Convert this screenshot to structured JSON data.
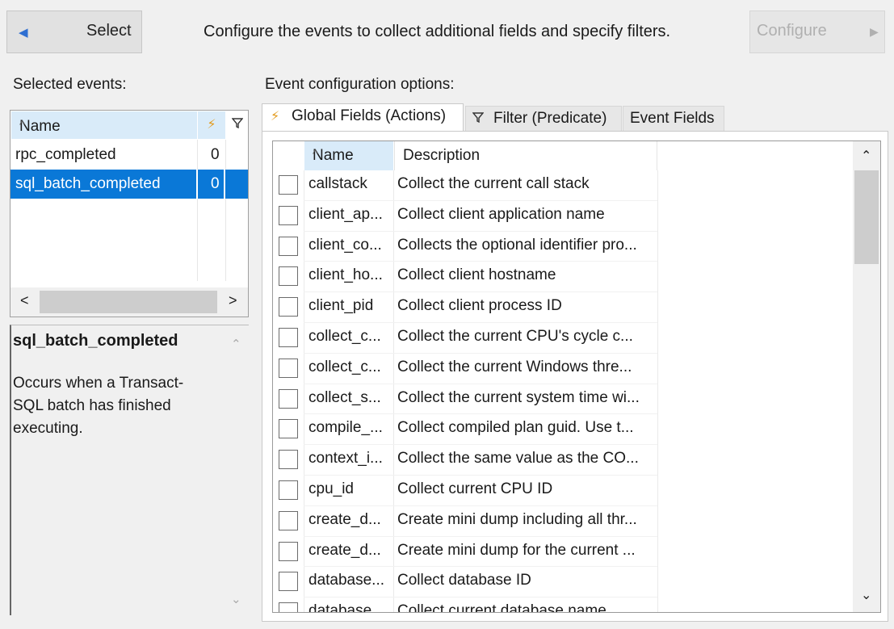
{
  "toolbar": {
    "select_label": "Select",
    "instruction": "Configure the events to collect additional fields and specify filters.",
    "configure_label": "Configure"
  },
  "selected_events": {
    "label": "Selected events:",
    "columns": {
      "name": "Name"
    },
    "rows": [
      {
        "name": "rpc_completed",
        "actions": "0",
        "selected": false
      },
      {
        "name": "sql_batch_completed",
        "actions": "0",
        "selected": true
      }
    ]
  },
  "description": {
    "title": "sql_batch_completed",
    "body": "Occurs when a Transact-SQL batch has finished executing."
  },
  "config": {
    "label": "Event configuration options:",
    "tabs": [
      {
        "label": "Global Fields (Actions)",
        "active": true
      },
      {
        "label": "Filter (Predicate)",
        "active": false
      },
      {
        "label": "Event Fields",
        "active": false
      }
    ],
    "grid": {
      "columns": {
        "name": "Name",
        "description": "Description"
      },
      "rows": [
        {
          "name": "callstack",
          "description": "Collect the current call stack"
        },
        {
          "name": "client_ap...",
          "description": "Collect client application name"
        },
        {
          "name": "client_co...",
          "description": "Collects the optional identifier pro..."
        },
        {
          "name": "client_ho...",
          "description": "Collect client hostname"
        },
        {
          "name": "client_pid",
          "description": "Collect client process ID"
        },
        {
          "name": "collect_c...",
          "description": "Collect the current CPU's cycle c..."
        },
        {
          "name": "collect_c...",
          "description": "Collect the current Windows thre..."
        },
        {
          "name": "collect_s...",
          "description": "Collect the current system time wi..."
        },
        {
          "name": "compile_...",
          "description": "Collect compiled plan guid. Use t..."
        },
        {
          "name": "context_i...",
          "description": "Collect the same value as the CO..."
        },
        {
          "name": "cpu_id",
          "description": "Collect current CPU ID"
        },
        {
          "name": "create_d...",
          "description": "Create mini dump including all thr..."
        },
        {
          "name": "create_d...",
          "description": "Create mini dump for the current ..."
        },
        {
          "name": "database...",
          "description": "Collect database ID"
        },
        {
          "name": "database...",
          "description": "Collect current database name"
        }
      ]
    }
  }
}
